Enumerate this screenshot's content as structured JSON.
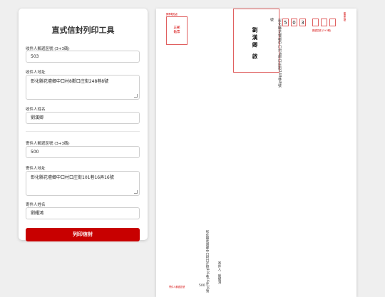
{
  "app": {
    "title": "直式信封列印工具",
    "print_button": "列印信封"
  },
  "form": {
    "recipient_zip_label": "收件人郵遞區號 (3+3碼)",
    "recipient_zip": "503",
    "recipient_address_label": "收件人地址",
    "recipient_address": "彰化縣花壇鄉中口村8鄰口庄街248巷8號",
    "recipient_name_label": "收件人姓名",
    "recipient_name": "劉漢卿",
    "sender_zip_label": "寄件人郵遞區號 (3+3碼)",
    "sender_zip": "500",
    "sender_address_label": "寄件人地址",
    "sender_address": "彰化縣花壇鄉中口村口庄街101巷16弄16號",
    "sender_name_label": "寄件人姓名",
    "sender_name": "劉耀鴻"
  },
  "envelope": {
    "stamp_area_label": "郵票黏貼處",
    "stamp_text_line1": "正郵",
    "stamp_text_line2": "黏票",
    "recipient_name_vertical": "劉漢卿 啟",
    "recipient_word": "號",
    "recipient_address_vertical": "彰化縣花壇鄉中口村8鄰口庄街248巷8號",
    "zip_digits": [
      "5",
      "0",
      "3",
      "",
      "",
      ""
    ],
    "zip_caption": "郵遞區號",
    "zip_note": "郵遞區號 (3+3碼)",
    "sender_address_vertical": "彰化縣花壇鄉中口村口庄街101巷16弄16號",
    "sender_info_vertical": "寄件人：劉耀鴻",
    "sender_zip_caption": "寄件人郵遞區號",
    "sender_zip_small": "500"
  },
  "colors": {
    "accent": "#c80000",
    "envelope_red": "#d40000"
  }
}
